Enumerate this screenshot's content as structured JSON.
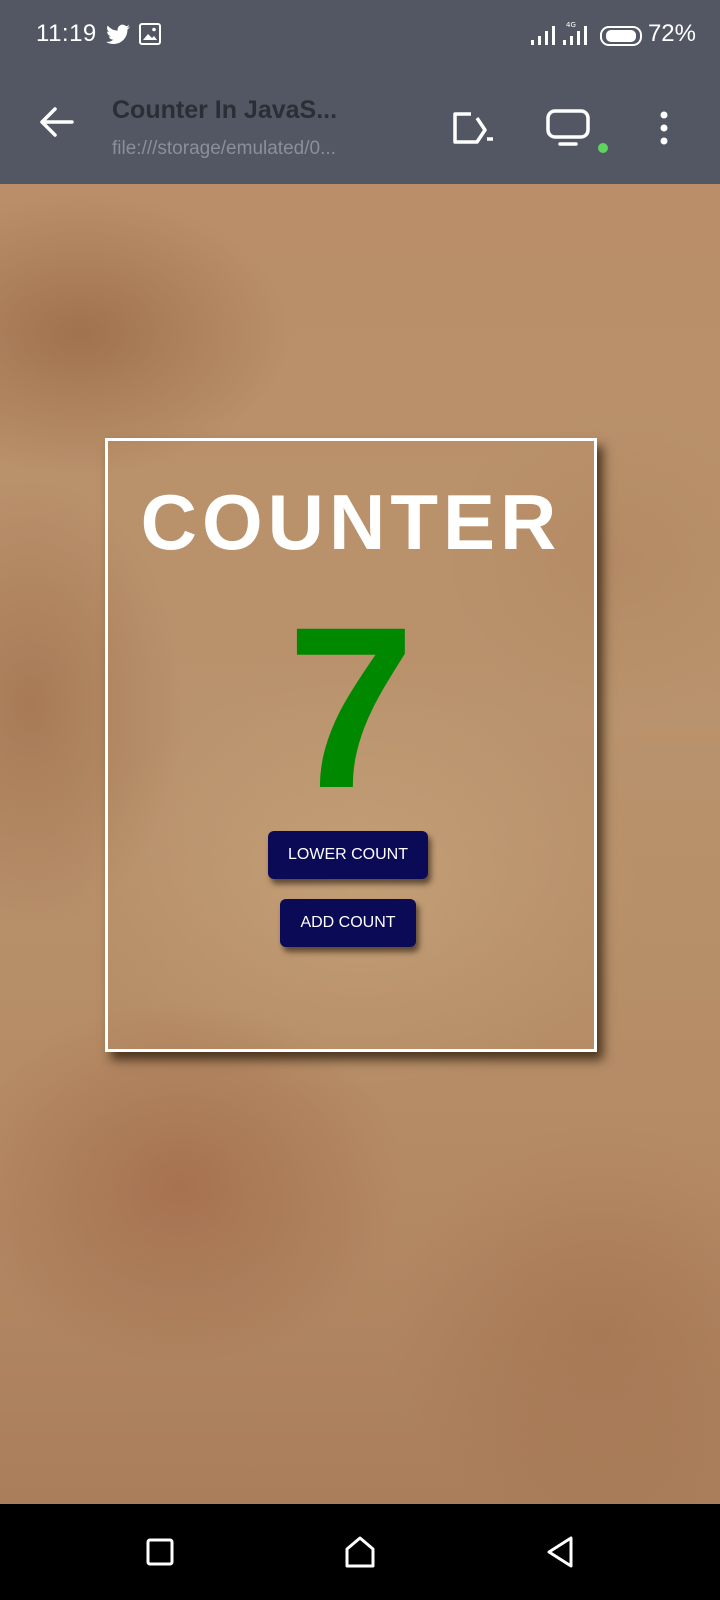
{
  "status_bar": {
    "time": "11:19",
    "battery": "72%",
    "icons": [
      "twitter-icon",
      "gallery-icon",
      "signal-icon",
      "signal-icon",
      "battery-icon"
    ]
  },
  "app_bar": {
    "title": "Counter In JavaS...",
    "url": "file:///storage/emulated/0...",
    "icons": [
      "back-arrow-icon",
      "open-in-icon",
      "desktop-icon",
      "more-vert-icon"
    ]
  },
  "page": {
    "heading": "COUNTER",
    "count_value": "7",
    "lower_button_label": "LOWER COUNT",
    "add_button_label": "ADD COUNT",
    "colors": {
      "count": "#008800",
      "button_bg": "#0b0a56",
      "card_border": "#ffffff"
    }
  },
  "nav_bar": {
    "icons": [
      "recents-icon",
      "home-icon",
      "back-icon"
    ]
  }
}
